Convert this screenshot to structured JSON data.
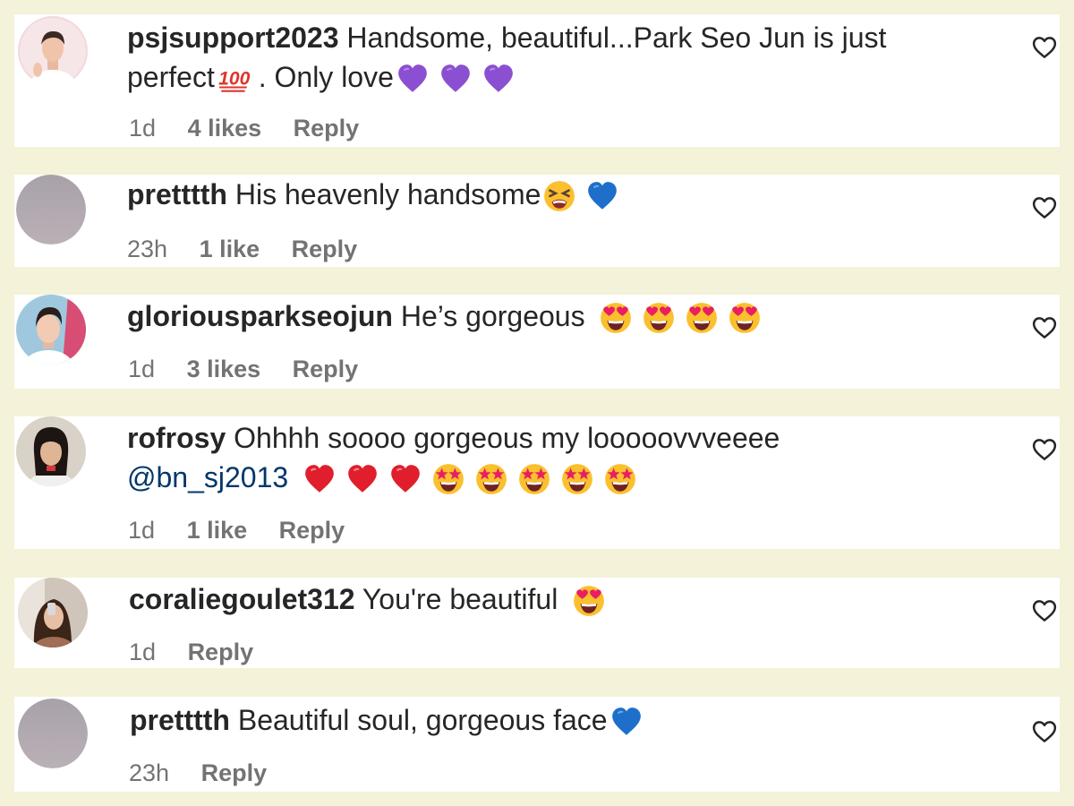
{
  "comments": [
    {
      "username": "psjsupport2023",
      "text_line1": "Handsome, beautiful...Park Seo Jun is just",
      "text_line2": "perfect",
      "text_line2b": ". Only love",
      "time": "1d",
      "likes": "4 likes",
      "reply": "Reply"
    },
    {
      "username": "pretttth",
      "text_line1": "His heavenly handsome",
      "time": "23h",
      "likes": "1 like",
      "reply": "Reply"
    },
    {
      "username": "gloriousparkseojun",
      "text_line1": "He’s gorgeous",
      "time": "1d",
      "likes": "3 likes",
      "reply": "Reply"
    },
    {
      "username": "rofrosy",
      "text_line1": "Ohhhh soooo gorgeous my looooovvveeee",
      "mention": "@bn_sj2013",
      "time": "1d",
      "likes": "1 like",
      "reply": "Reply"
    },
    {
      "username": "coraliegoulet312",
      "text_line1": "You're beautiful",
      "time": "1d",
      "reply": "Reply"
    },
    {
      "username": "pretttth",
      "text_line1": "Beautiful soul, gorgeous face",
      "time": "23h",
      "reply": "Reply"
    }
  ],
  "icons": {
    "like": "heart-outline-icon",
    "emoji": [
      "purple-heart",
      "hundred-points",
      "tired-face",
      "blue-heart",
      "heart-eyes",
      "red-heart",
      "star-struck"
    ]
  },
  "colors": {
    "background": "#f4f2d8",
    "card": "#ffffff",
    "text": "#262626",
    "meta": "#737373",
    "mention": "#00376b"
  }
}
